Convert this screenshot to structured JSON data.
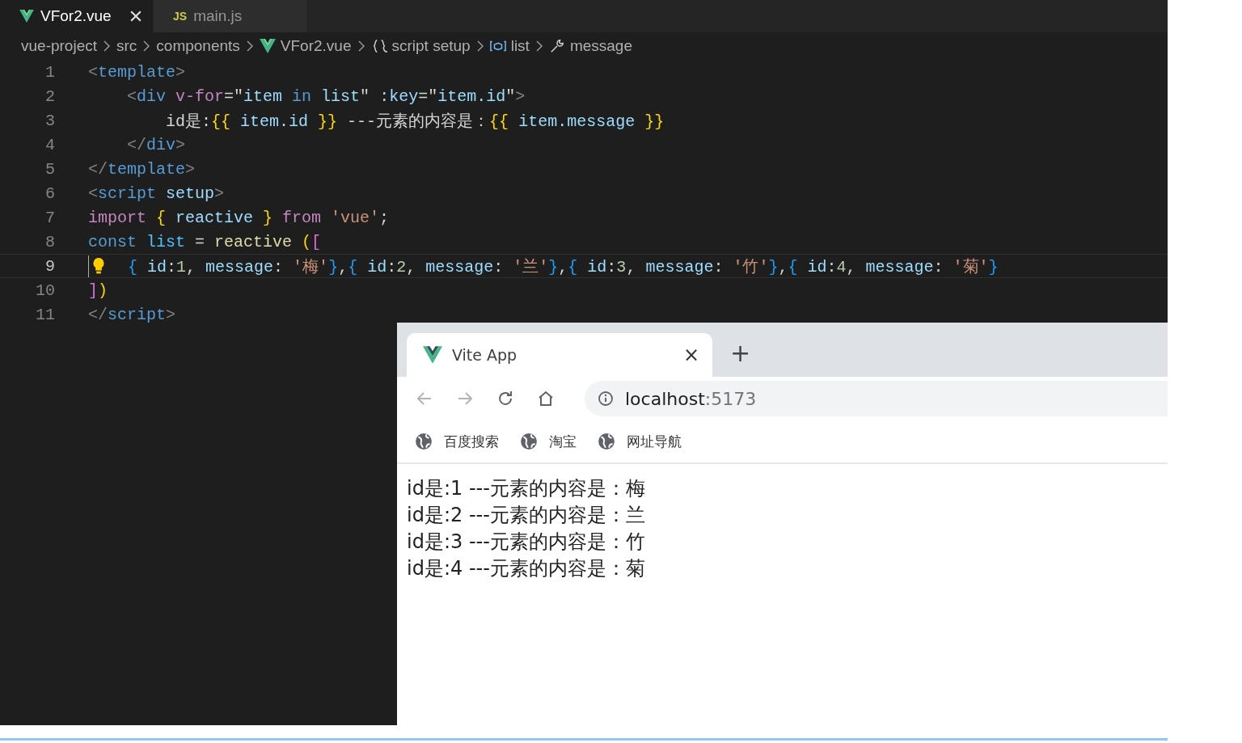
{
  "editor": {
    "tabs": [
      {
        "label": "VFor2.vue",
        "kind": "vue",
        "selected": true
      },
      {
        "label": "main.js",
        "kind": "js",
        "icon_text": "JS",
        "selected": false
      }
    ],
    "breadcrumbs": [
      {
        "label": "vue-project"
      },
      {
        "label": "src"
      },
      {
        "label": "components"
      },
      {
        "label": "VFor2.vue",
        "kind": "vue"
      },
      {
        "label": "script setup",
        "kind": "braces"
      },
      {
        "label": "list",
        "kind": "variable"
      },
      {
        "label": "message",
        "kind": "wrench"
      }
    ],
    "lines": [
      {
        "number": "1",
        "active": false,
        "hint": false,
        "tokens": [
          {
            "kind": "punct",
            "text": "<"
          },
          {
            "kind": "tag",
            "text": "template"
          },
          {
            "kind": "punct",
            "text": ">"
          }
        ]
      },
      {
        "number": "2",
        "active": false,
        "hint": false,
        "tokens": [
          {
            "kind": "punct",
            "text": "    <"
          },
          {
            "kind": "tag",
            "text": "div"
          },
          {
            "kind": "directive",
            "text": " v-for"
          },
          {
            "kind": "text",
            "text": "=\""
          },
          {
            "kind": "attr",
            "text": "item"
          },
          {
            "kind": "keyword",
            "text": " in "
          },
          {
            "kind": "attr",
            "text": "list"
          },
          {
            "kind": "text",
            "text": "\" "
          },
          {
            "kind": "attr",
            "text": ":key"
          },
          {
            "kind": "text",
            "text": "=\""
          },
          {
            "kind": "attr",
            "text": "item.id"
          },
          {
            "kind": "text",
            "text": "\""
          },
          {
            "kind": "punct",
            "text": ">"
          }
        ]
      },
      {
        "number": "3",
        "active": false,
        "hint": false,
        "tokens": [
          {
            "kind": "text",
            "text": "        id是:"
          },
          {
            "kind": "bracket1",
            "text": "{{"
          },
          {
            "kind": "attr",
            "text": " item.id "
          },
          {
            "kind": "bracket1",
            "text": "}}"
          },
          {
            "kind": "text",
            "text": " ---元素的内容是："
          },
          {
            "kind": "bracket1",
            "text": "{{"
          },
          {
            "kind": "attr",
            "text": " item.message "
          },
          {
            "kind": "bracket1",
            "text": "}}"
          }
        ]
      },
      {
        "number": "4",
        "active": false,
        "hint": false,
        "tokens": [
          {
            "kind": "punct",
            "text": "    </"
          },
          {
            "kind": "tag",
            "text": "div"
          },
          {
            "kind": "punct",
            "text": ">"
          }
        ]
      },
      {
        "number": "5",
        "active": false,
        "hint": false,
        "tokens": [
          {
            "kind": "punct",
            "text": "</"
          },
          {
            "kind": "tag",
            "text": "template"
          },
          {
            "kind": "punct",
            "text": ">"
          }
        ]
      },
      {
        "number": "6",
        "active": false,
        "hint": false,
        "tokens": [
          {
            "kind": "punct",
            "text": "<"
          },
          {
            "kind": "tag",
            "text": "script"
          },
          {
            "kind": "attr",
            "text": " setup"
          },
          {
            "kind": "punct",
            "text": ">"
          }
        ]
      },
      {
        "number": "7",
        "active": false,
        "hint": false,
        "tokens": [
          {
            "kind": "control",
            "text": "import"
          },
          {
            "kind": "bracket1",
            "text": " { "
          },
          {
            "kind": "attr",
            "text": "reactive"
          },
          {
            "kind": "bracket1",
            "text": " } "
          },
          {
            "kind": "control",
            "text": "from"
          },
          {
            "kind": "string",
            "text": " 'vue'"
          },
          {
            "kind": "text",
            "text": ";"
          }
        ]
      },
      {
        "number": "8",
        "active": false,
        "hint": false,
        "tokens": [
          {
            "kind": "keyword",
            "text": "const"
          },
          {
            "kind": "const",
            "text": " list"
          },
          {
            "kind": "text",
            "text": " = "
          },
          {
            "kind": "func",
            "text": "reactive"
          },
          {
            "kind": "bracket1",
            "text": " ("
          },
          {
            "kind": "bracket2",
            "text": "["
          }
        ]
      },
      {
        "number": "9",
        "active": true,
        "hint": true,
        "tokens": [
          {
            "kind": "bracket3",
            "text": "  {"
          },
          {
            "kind": "attr",
            "text": " id"
          },
          {
            "kind": "text",
            "text": ":"
          },
          {
            "kind": "num",
            "text": "1"
          },
          {
            "kind": "text",
            "text": ", "
          },
          {
            "kind": "attr",
            "text": "message"
          },
          {
            "kind": "text",
            "text": ": "
          },
          {
            "kind": "string",
            "text": "'梅'"
          },
          {
            "kind": "bracket3",
            "text": "}"
          },
          {
            "kind": "text",
            "text": ","
          },
          {
            "kind": "bracket3",
            "text": "{"
          },
          {
            "kind": "attr",
            "text": " id"
          },
          {
            "kind": "text",
            "text": ":"
          },
          {
            "kind": "num",
            "text": "2"
          },
          {
            "kind": "text",
            "text": ", "
          },
          {
            "kind": "attr",
            "text": "message"
          },
          {
            "kind": "text",
            "text": ": "
          },
          {
            "kind": "string",
            "text": "'兰'"
          },
          {
            "kind": "bracket3",
            "text": "}"
          },
          {
            "kind": "text",
            "text": ","
          },
          {
            "kind": "bracket3",
            "text": "{"
          },
          {
            "kind": "attr",
            "text": " id"
          },
          {
            "kind": "text",
            "text": ":"
          },
          {
            "kind": "num",
            "text": "3"
          },
          {
            "kind": "text",
            "text": ", "
          },
          {
            "kind": "attr",
            "text": "message"
          },
          {
            "kind": "text",
            "text": ": "
          },
          {
            "kind": "string",
            "text": "'竹'"
          },
          {
            "kind": "bracket3",
            "text": "}"
          },
          {
            "kind": "text",
            "text": ","
          },
          {
            "kind": "bracket3",
            "text": "{"
          },
          {
            "kind": "attr",
            "text": " id"
          },
          {
            "kind": "text",
            "text": ":"
          },
          {
            "kind": "num",
            "text": "4"
          },
          {
            "kind": "text",
            "text": ", "
          },
          {
            "kind": "attr",
            "text": "message"
          },
          {
            "kind": "text",
            "text": ": "
          },
          {
            "kind": "string",
            "text": "'菊'"
          },
          {
            "kind": "bracket3",
            "text": "}"
          }
        ]
      },
      {
        "number": "10",
        "active": false,
        "hint": false,
        "tokens": [
          {
            "kind": "bracket2",
            "text": "]"
          },
          {
            "kind": "bracket1",
            "text": ")"
          }
        ]
      },
      {
        "number": "11",
        "active": false,
        "hint": false,
        "tokens": [
          {
            "kind": "punct",
            "text": "</"
          },
          {
            "kind": "tag",
            "text": "script"
          },
          {
            "kind": "punct",
            "text": ">"
          }
        ]
      }
    ]
  },
  "browser": {
    "tab": {
      "title": "Vite App"
    },
    "tab_close": "×",
    "new_tab": "+",
    "nav": [
      {
        "kind": "back",
        "disabled": true
      },
      {
        "kind": "forward",
        "disabled": true
      },
      {
        "kind": "reload",
        "disabled": false
      },
      {
        "kind": "home",
        "disabled": false
      }
    ],
    "address": {
      "host": "localhost",
      "port": ":5173"
    },
    "bookmarks": [
      {
        "label": "百度搜索"
      },
      {
        "label": "淘宝"
      },
      {
        "label": "网址导航"
      }
    ],
    "content": [
      "id是:1 ---元素的内容是：梅",
      "id是:2 ---元素的内容是：兰",
      "id是:3 ---元素的内容是：竹",
      "id是:4 ---元素的内容是：菊"
    ]
  }
}
